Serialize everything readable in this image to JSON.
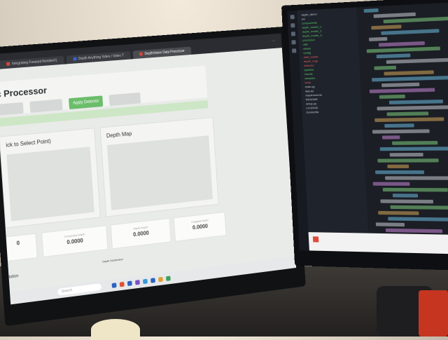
{
  "browser": {
    "tabs": [
      {
        "label": "Integrating Forward Render#1",
        "fav": "red"
      },
      {
        "label": "Depth Anything Video / Video T",
        "fav": "blue"
      },
      {
        "label": "DepthVision Data Processor",
        "fav": "red"
      }
    ],
    "menu_label": "···"
  },
  "app": {
    "title": "c Processor",
    "buttons": [
      "",
      "",
      "Apply Detector",
      ""
    ],
    "panels": {
      "left_title": "ick to Select Point)",
      "right_title": "Depth Map"
    },
    "stats": [
      {
        "label": "",
        "value": "0"
      },
      {
        "label": "Connected Depth",
        "value": "0.0000"
      },
      {
        "label": "Depth Depth",
        "value": "0.0000"
      },
      {
        "label": "Cropped Depth",
        "value": "0.0000"
      }
    ],
    "bottom_left": "lution",
    "bottom_right": "Depth Distribution"
  },
  "taskbar": {
    "search_placeholder": "Search",
    "icon_colors": [
      "#2c62c0",
      "#e05030",
      "#2c62c0",
      "#7a4fc8",
      "#3a9ad8",
      "#2c62c0",
      "#e0a030",
      "#40a060"
    ]
  },
  "ide": {
    "explorer_items": [
      {
        "label": "depth_demo",
        "tone": ""
      },
      {
        "label": "src",
        "tone": ""
      },
      {
        "label": "components",
        "tone": "g"
      },
      {
        "label": "depth_model_1",
        "tone": "g"
      },
      {
        "label": "depth_model_2",
        "tone": "g"
      },
      {
        "label": "depth_model_3",
        "tone": "g"
      },
      {
        "label": "processor",
        "tone": "g"
      },
      {
        "label": "utils",
        "tone": "g"
      },
      {
        "label": "viewer",
        "tone": "g"
      },
      {
        "label": "config",
        "tone": "g"
      },
      {
        "label": "data_loader",
        "tone": "r"
      },
      {
        "label": "depth_map",
        "tone": "r"
      },
      {
        "label": "detector",
        "tone": "r"
      },
      {
        "label": "pipeline",
        "tone": "g"
      },
      {
        "label": "results",
        "tone": "g"
      },
      {
        "label": "samples",
        "tone": "g"
      },
      {
        "label": "tests",
        "tone": "r"
      },
      {
        "label": "main.py",
        "tone": ""
      },
      {
        "label": "app.py",
        "tone": ""
      },
      {
        "label": "requirements",
        "tone": ""
      },
      {
        "label": "README",
        "tone": ""
      },
      {
        "label": "setup.py",
        "tone": ""
      },
      {
        "label": "LICENSE",
        "tone": ""
      },
      {
        "label": "Dockerfile",
        "tone": ""
      }
    ],
    "code_colors": [
      "#6cbbe0",
      "#c9cdd4",
      "#7fcf7f",
      "#d6a85a",
      "#6cbbe0",
      "#c9cdd4",
      "#c987d8",
      "#7fcf7f"
    ]
  }
}
